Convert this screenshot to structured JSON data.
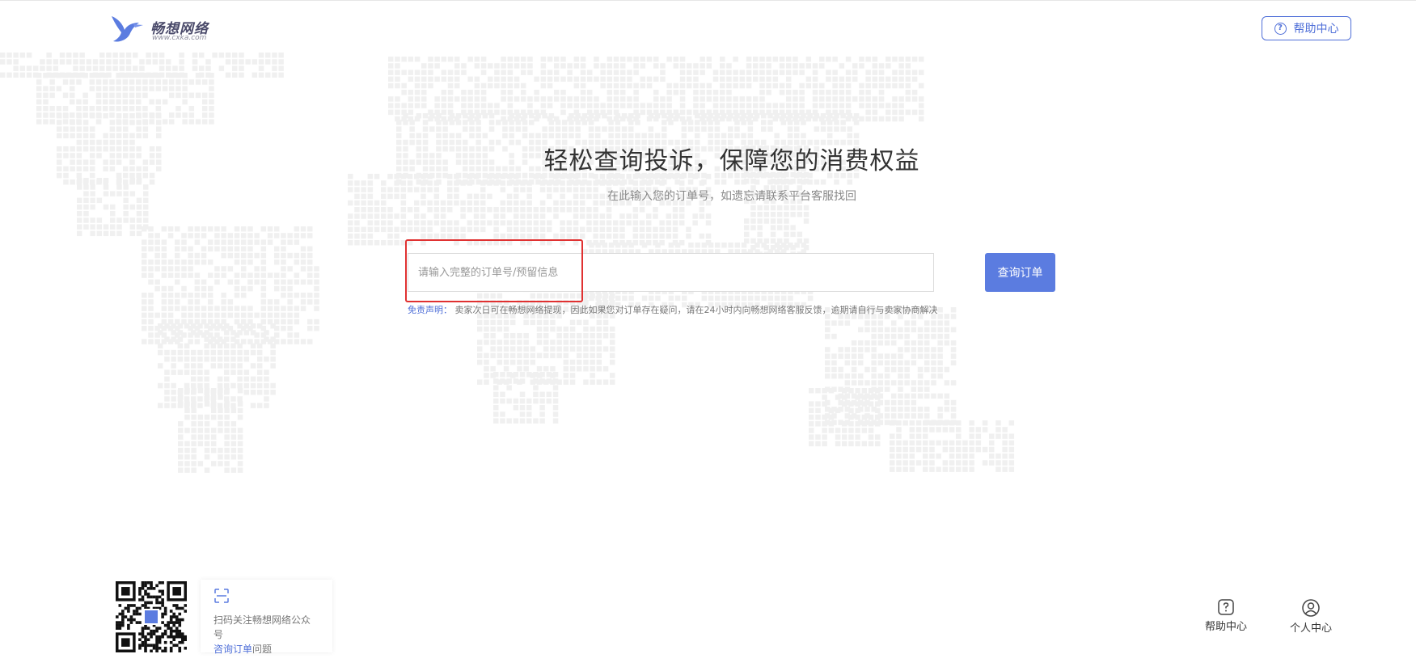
{
  "header": {
    "logo_name": "畅想网络",
    "logo_url": "www.cxka.com",
    "help_label": "帮助中心"
  },
  "hero": {
    "title": "轻松查询投诉，保障您的消费权益",
    "subtitle": "在此输入您的订单号，如遗忘请联系平台客服找回"
  },
  "search": {
    "placeholder": "请输入完整的订单号/预留信息",
    "value": "",
    "button_label": "查询订单"
  },
  "disclaimer": {
    "label": "免责声明：",
    "text": "卖家次日可在畅想网络提现，因此如果您对订单存在疑问，请在24小时内向畅想网络客服反馈，逾期请自行与卖家协商解决"
  },
  "footer": {
    "qr_line1": "扫码关注畅想网络公众号",
    "qr_link": "咨询订单",
    "qr_suffix": "问题",
    "help_label": "帮助中心",
    "user_label": "个人中心"
  },
  "icons": {
    "help_top": "help-circle-icon",
    "scan": "scan-icon",
    "help_footer": "help-square-icon",
    "user": "user-circle-icon"
  },
  "colors": {
    "accent": "#5b7ce0",
    "link": "#4f6fd8",
    "highlight": "#e03131",
    "map_dots": "#f0f0f0"
  }
}
